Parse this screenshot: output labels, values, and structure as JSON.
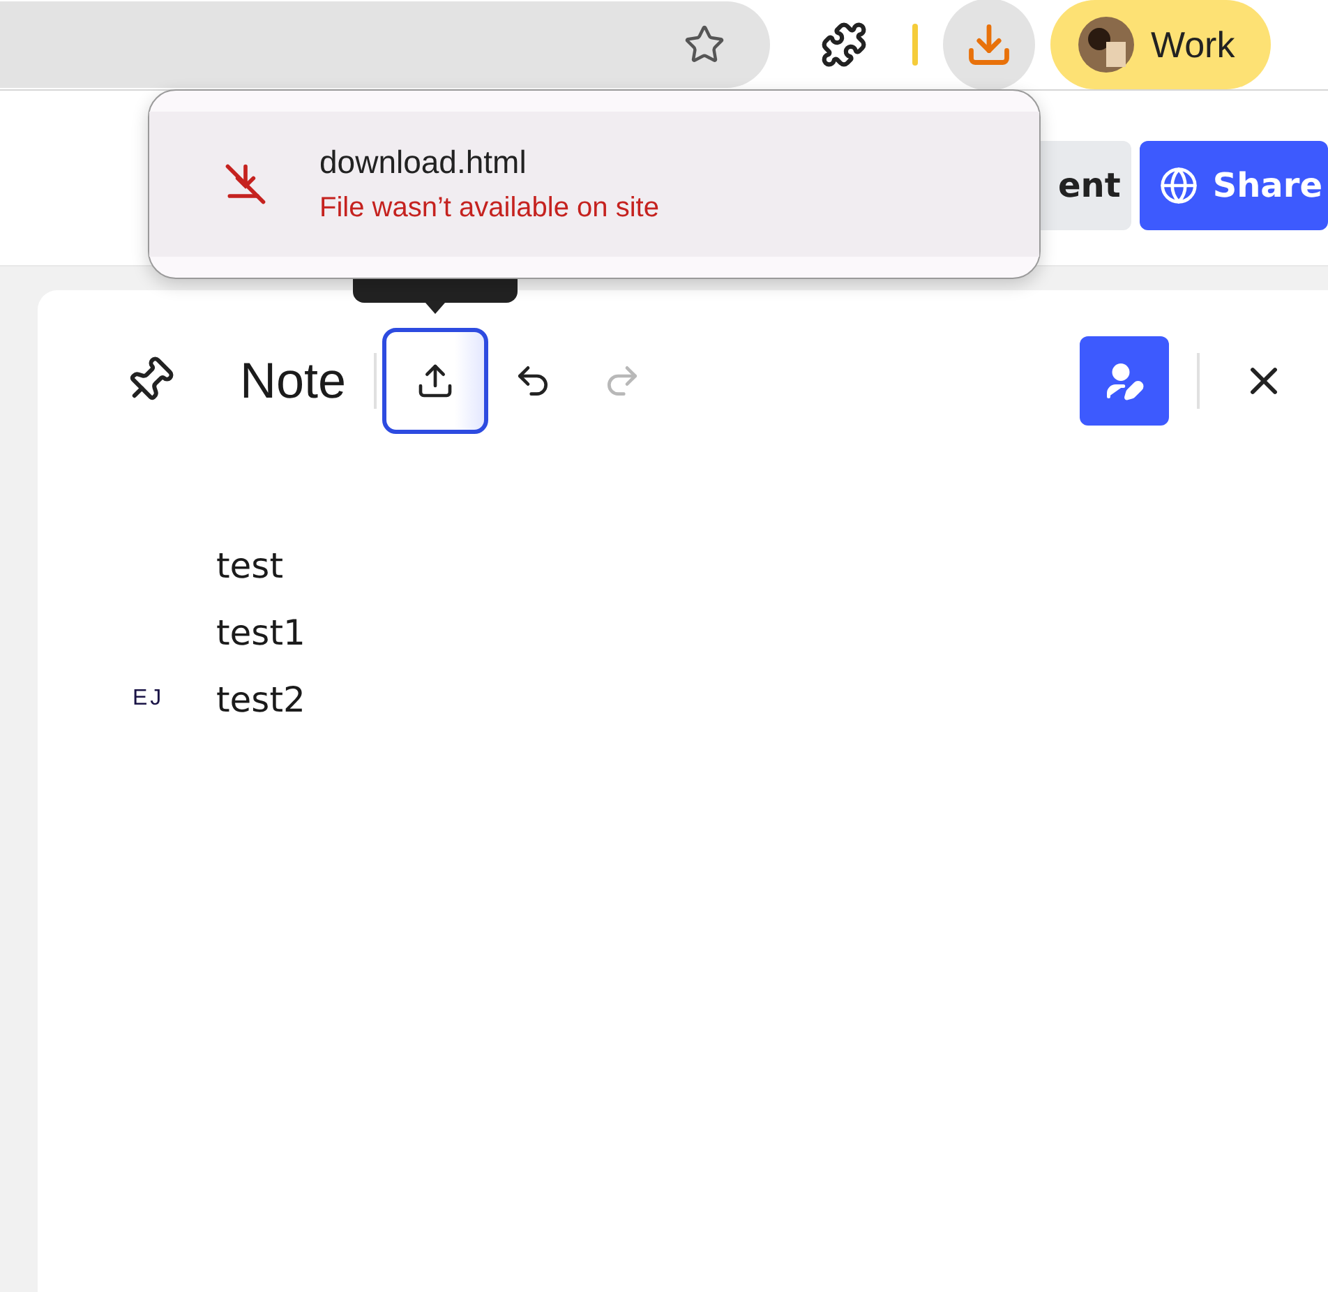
{
  "browser_toolbar": {
    "profile": {
      "label": "Work"
    }
  },
  "download_popup": {
    "items": [
      {
        "filename": "download.html",
        "status": "File wasn’t available on site",
        "failed": true
      }
    ]
  },
  "page_header": {
    "buttons": [
      {
        "label": "ent",
        "kind": "secondary"
      },
      {
        "label": "Share",
        "kind": "primary"
      }
    ]
  },
  "note": {
    "title": "Note",
    "tools": [
      {
        "kind": "upload",
        "focused": true,
        "disabled": false
      },
      {
        "kind": "undo",
        "focused": false,
        "disabled": false
      },
      {
        "kind": "redo",
        "focused": false,
        "disabled": true
      }
    ],
    "lines": [
      {
        "text": "test"
      },
      {
        "text": "test1"
      },
      {
        "text": "test2",
        "author": "EJ"
      }
    ]
  }
}
